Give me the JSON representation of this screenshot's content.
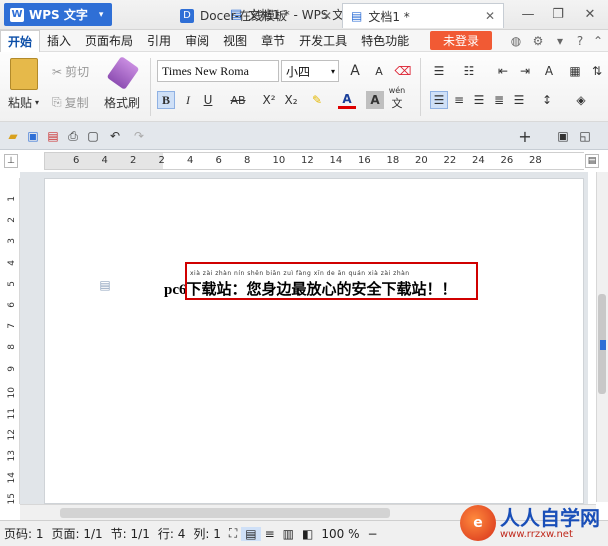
{
  "app": {
    "menu_button": "WPS 文字",
    "window_title": "文档1 * - WPS 文字"
  },
  "menu": {
    "items": [
      "开始",
      "插入",
      "页面布局",
      "引用",
      "审阅",
      "视图",
      "章节",
      "开发工具",
      "特色功能"
    ],
    "login": "未登录"
  },
  "ribbon": {
    "paste": "粘贴",
    "cut": "剪切",
    "copy": "复制",
    "format_painter": "格式刷",
    "font_name": "Times New Roma",
    "font_size": "小四",
    "bold": "B",
    "italic": "I",
    "underline": "U",
    "strike": "AB",
    "superscript": "X²",
    "subscript": "X₂",
    "grow_font": "A",
    "shrink_font": "A",
    "pinyin_guide": "wén"
  },
  "tabs": [
    {
      "label": "Docer-在线模板"
    },
    {
      "label": "文档1 *"
    }
  ],
  "ruler": {
    "h_ticks": [
      "6",
      "4",
      "2",
      "2",
      "4",
      "6",
      "8",
      "10",
      "12",
      "14",
      "16",
      "18",
      "20",
      "22",
      "24",
      "26",
      "28"
    ],
    "v_ticks": [
      "1",
      "2",
      "3",
      "4",
      "5",
      "6",
      "7",
      "8",
      "9",
      "10",
      "11",
      "12",
      "13",
      "14",
      "15"
    ]
  },
  "document": {
    "text": "pc6下载站：您身边最放心的安全下载站！！",
    "pinyin": "xià zài zhàn   nín shēn biān zuì fàng xīn de  ān quán xià zài zhàn"
  },
  "status": {
    "page": "页码: 1",
    "pages": "页面: 1/1",
    "section": "节: 1/1",
    "row": "行: 4",
    "col": "列: 1",
    "zoom": "100 %",
    "zoom_minus": "−"
  },
  "watermark": {
    "title": "人人自学网",
    "url": "www.rrzxw.net"
  }
}
